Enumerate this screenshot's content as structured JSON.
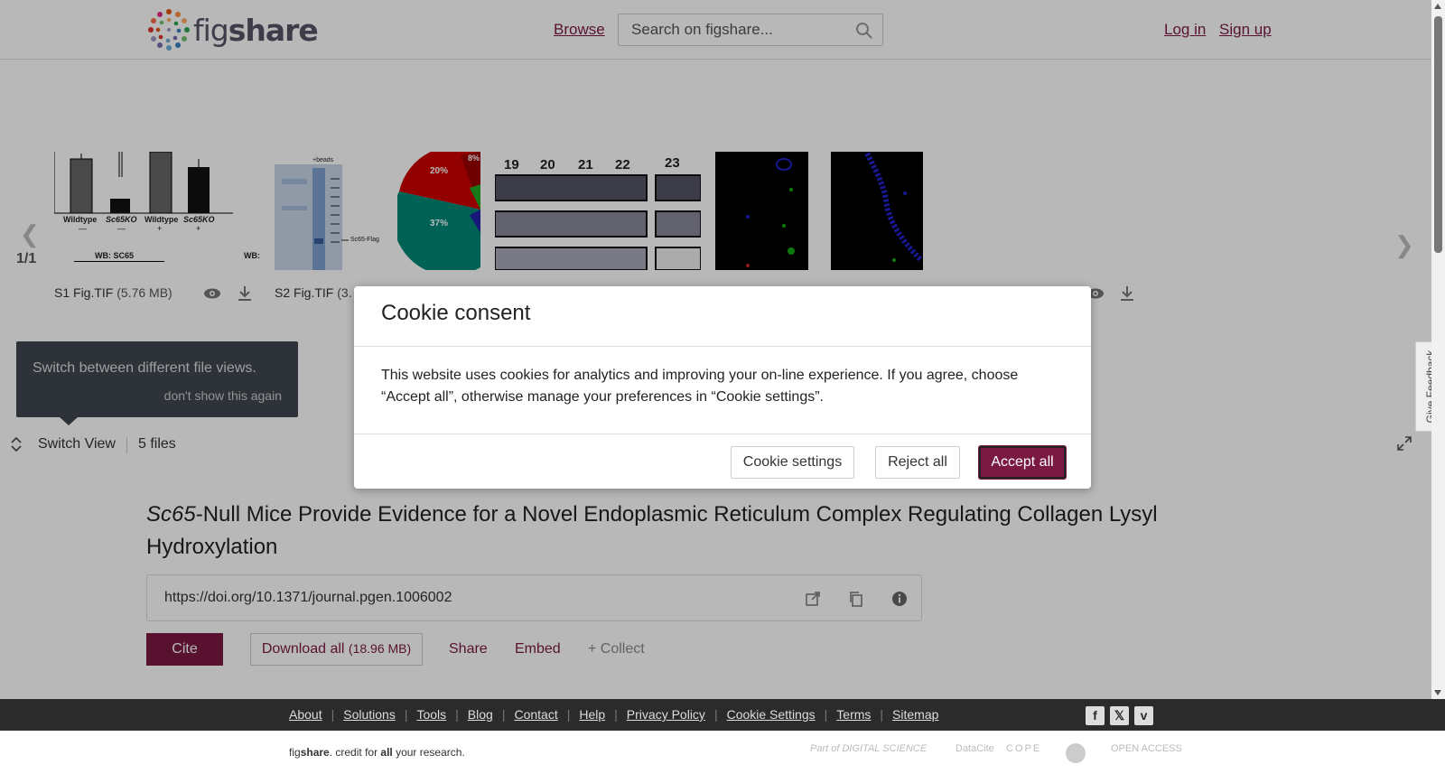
{
  "header": {
    "logo_fig": "fig",
    "logo_share": "share",
    "browse": "Browse",
    "search_placeholder": "Search on figshare...",
    "login": "Log in",
    "signup": "Sign up"
  },
  "gallery": {
    "counter": "1/1",
    "files": [
      {
        "name": "S1 Fig.TIF",
        "size": "(5.76 MB)"
      },
      {
        "name": "S2 Fig.TIF",
        "size": "(3."
      }
    ],
    "thumb_text": {
      "s1_wildtype": "Wildtype",
      "s1_ko": "Sc65KO",
      "s1_minus": "—",
      "s1_plus": "+",
      "s1_wb": "WB: SC65",
      "s1_wb2": "WB:",
      "s2_flag": "+beads",
      "s2_label": "Sc65-Flag",
      "pie_20": "20%",
      "pie_37": "37%",
      "pie_8": "8%",
      "lanes": [
        "19",
        "20",
        "21",
        "22",
        "23"
      ]
    },
    "tooltip_text": "Switch between different file views.",
    "tooltip_dismiss": "don't show this again",
    "switch_view": "Switch View",
    "file_count": "5 files",
    "feedback": "Give Feedback"
  },
  "article": {
    "title_italic": "Sc65",
    "title_rest": "-Null Mice Provide Evidence for a Novel Endoplasmic Reticulum Complex Regulating Collagen Lysyl Hydroxylation",
    "doi": "https://doi.org/10.1371/journal.pgen.1006002",
    "cite": "Cite",
    "download_all": "Download all",
    "download_size": "(18.96 MB)",
    "share": "Share",
    "embed": "Embed",
    "collect": "+ Collect"
  },
  "cookie": {
    "title": "Cookie consent",
    "body": "This website uses cookies for analytics and improving your on-line experience. If you agree, choose “Accept all”, otherwise manage your preferences in “Cookie settings”.",
    "settings": "Cookie settings",
    "reject": "Reject all",
    "accept": "Accept all"
  },
  "footer": {
    "links": [
      "About",
      "Solutions",
      "Tools",
      "Blog",
      "Contact",
      "Help",
      "Privacy Policy",
      "Cookie Settings",
      "Terms",
      "Sitemap"
    ],
    "credit_fig": "fig",
    "credit_share": "share",
    "credit_mid": ". credit for ",
    "credit_all": "all",
    "credit_end": " your research.",
    "partners": [
      "Part of DIGITAL SCIENCE",
      "DataCite",
      "COPE",
      "OPEN ACCESS"
    ],
    "social": [
      "facebook-icon",
      "x-icon",
      "vimeo-icon"
    ]
  },
  "colors": {
    "brand": "#7a1a42",
    "footer_bg": "#2b2b2b"
  }
}
